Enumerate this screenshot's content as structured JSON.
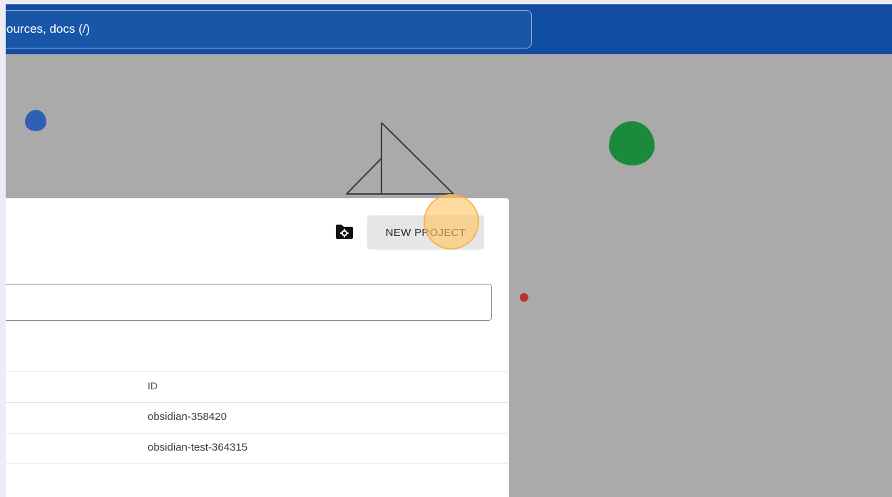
{
  "header": {
    "search_text": "ources, docs (/)"
  },
  "dialog": {
    "new_project_label": "NEW PROJECT",
    "filter_value": "",
    "table": {
      "columns": [
        "ID"
      ],
      "rows": [
        {
          "id": "obsidian-358420"
        },
        {
          "id": "obsidian-test-364315"
        }
      ]
    }
  },
  "icons": {
    "folder_settings": "folder-settings-icon"
  },
  "colors": {
    "header": "#114ea2",
    "overlay": "#aaaaaa",
    "accent_highlight": "#f5b04a"
  }
}
